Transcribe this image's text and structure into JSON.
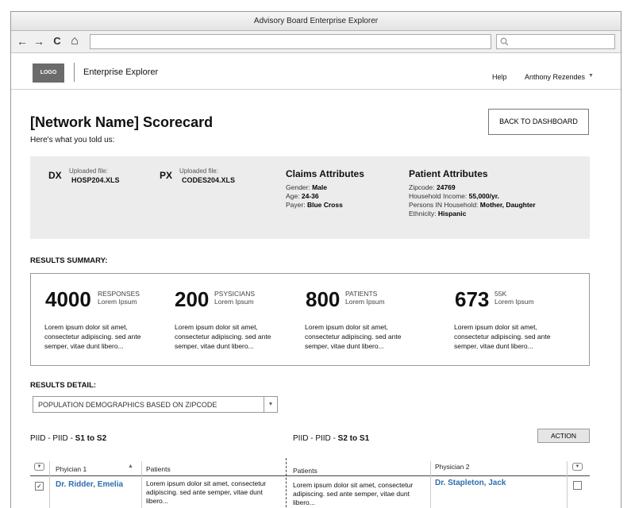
{
  "window": {
    "title": "Advisory Board Enterprise Explorer"
  },
  "browser": {
    "back": "←",
    "forward": "→",
    "reload": "C",
    "home": "⌂",
    "url": "",
    "search": ""
  },
  "header": {
    "logo": "LOGO",
    "app_title": "Enterprise Explorer",
    "help": "Help",
    "user": "Anthony Rezendes"
  },
  "page": {
    "title": "[Network Name] Scorecard",
    "subtitle": "Here's what you told us:",
    "back_button": "BACK TO DASHBOARD"
  },
  "uploads": [
    {
      "tag": "DX",
      "label": "Uploaded file:",
      "file": "HOSP204.XLS"
    },
    {
      "tag": "PX",
      "label": "Uploaded file:",
      "file": "CODES204.XLS"
    }
  ],
  "claims": {
    "title": "Claims Attributes",
    "rows": [
      {
        "label": "Gender:",
        "value": "Male"
      },
      {
        "label": "Age:",
        "value": "24-36"
      },
      {
        "label": "Payer:",
        "value": "Blue Cross"
      }
    ]
  },
  "patient": {
    "title": "Patient Attributes",
    "rows": [
      {
        "label": "Zipcode:",
        "value": "24769"
      },
      {
        "label": "Household Income:",
        "value": "55,000/yr."
      },
      {
        "label": "Persons IN Household:",
        "value": "Mother, Daughter"
      },
      {
        "label": "Ethnicity:",
        "value": "Hispanic"
      }
    ]
  },
  "summary": {
    "label": "RESULTS SUMMARY:",
    "stats": [
      {
        "num": "4000",
        "l1": "RESPONSES",
        "l2": "Lorem Ipsum",
        "desc": "Lorem ipsum dolor sit amet, consectetur adipiscing. sed ante semper, vitae dunt libero..."
      },
      {
        "num": "200",
        "l1": "PSYSICIANS",
        "l2": "Lorem Ipsum",
        "desc": "Lorem ipsum dolor sit amet, consectetur adipiscing. sed ante semper, vitae dunt libero..."
      },
      {
        "num": "800",
        "l1": "PATIENTS",
        "l2": "Lorem Ipsum",
        "desc": "Lorem ipsum dolor sit amet, consectetur adipiscing. sed ante semper, vitae dunt libero..."
      },
      {
        "num": "673",
        "l1": "55K",
        "l2": "Lorem Ipsum",
        "desc": "Lorem ipsum dolor sit amet, consectetur adipiscing. sed ante semper, vitae dunt libero..."
      }
    ]
  },
  "detail": {
    "label": "RESULTS DETAIL:",
    "dropdown": "POPULATION DEMOGRAPHICS BASED ON ZIPCODE",
    "left_prefix": "PIID - PIID - ",
    "left_bold": "S1 to S2",
    "right_prefix": "PIID - PIID - ",
    "right_bold": "S2 to S1",
    "action": "ACTION",
    "columns": {
      "physician1": "Phyician 1",
      "patients_left": "Patients",
      "patients_right": "Patients",
      "physician2": "Physician 2"
    },
    "rows": [
      {
        "physician1": "Dr. Ridder, Emelia",
        "patients_left": "Lorem ipsum dolor sit amet, consectetur adipiscing. sed ante semper, vitae dunt libero...",
        "patients_right": "Lorem ipsum dolor sit amet, consectetur adipiscing. sed ante semper, vitae dunt libero...",
        "physician2": "Dr. Stapleton, Jack",
        "left_checked": true,
        "right_checked": false
      }
    ]
  },
  "colors": {
    "link": "#2a6eb0",
    "info_bg": "#ececec",
    "logo_bg": "#6b6b6b"
  }
}
